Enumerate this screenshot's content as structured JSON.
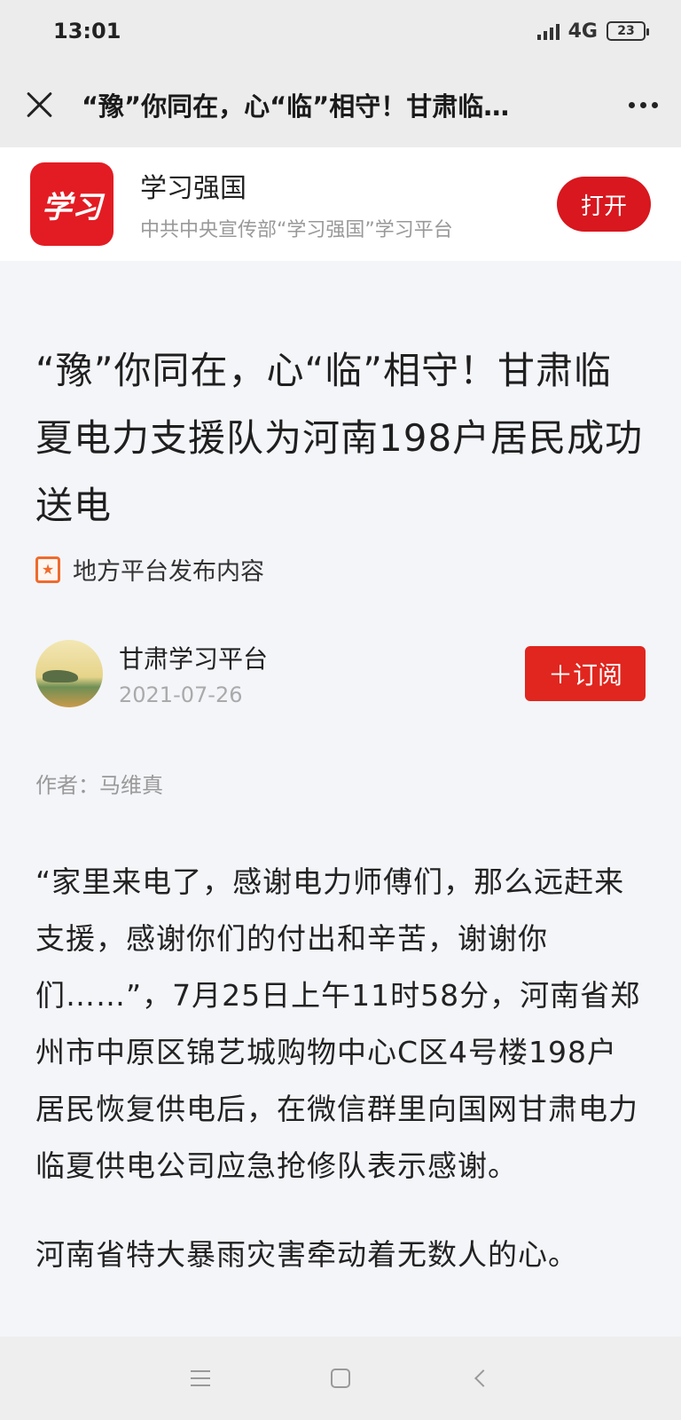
{
  "status_bar": {
    "time": "13:01",
    "network": "4G",
    "battery": "23"
  },
  "nav_bar": {
    "title": "“豫”你同在，心“临”相守！甘肃临…",
    "close_icon": "close-icon",
    "more_icon": "more-icon"
  },
  "app_banner": {
    "logo_text": "学习",
    "name": "学习强国",
    "description": "中共中央宣传部“学习强国”学习平台",
    "open_label": "打开",
    "brand_color": "#e31c23"
  },
  "article": {
    "title": "“豫”你同在，心“临”相守！甘肃临夏电力支援队为河南198户居民成功送电",
    "source_label": "地方平台发布内容",
    "author_name": "甘肃学习平台",
    "date": "2021-07-26",
    "subscribe_label": "＋订阅",
    "byline": "作者：马维真",
    "paragraphs": [
      "“家里来电了，感谢电力师傅们，那么远赶来支援，感谢你们的付出和辛苦，谢谢你们……”，7月25日上午11时58分，河南省郑州市中原区锦艺城购物中心C区4号楼198户居民恢复供电后，在微信群里向国网甘肃电力临夏供电公司应急抢修队表示感谢。",
      "河南省特大暴雨灾害牵动着无数人的心。"
    ]
  },
  "bottom_nav": {
    "menu_icon": "menu-icon",
    "home_icon": "home-icon",
    "back_icon": "back-icon"
  }
}
